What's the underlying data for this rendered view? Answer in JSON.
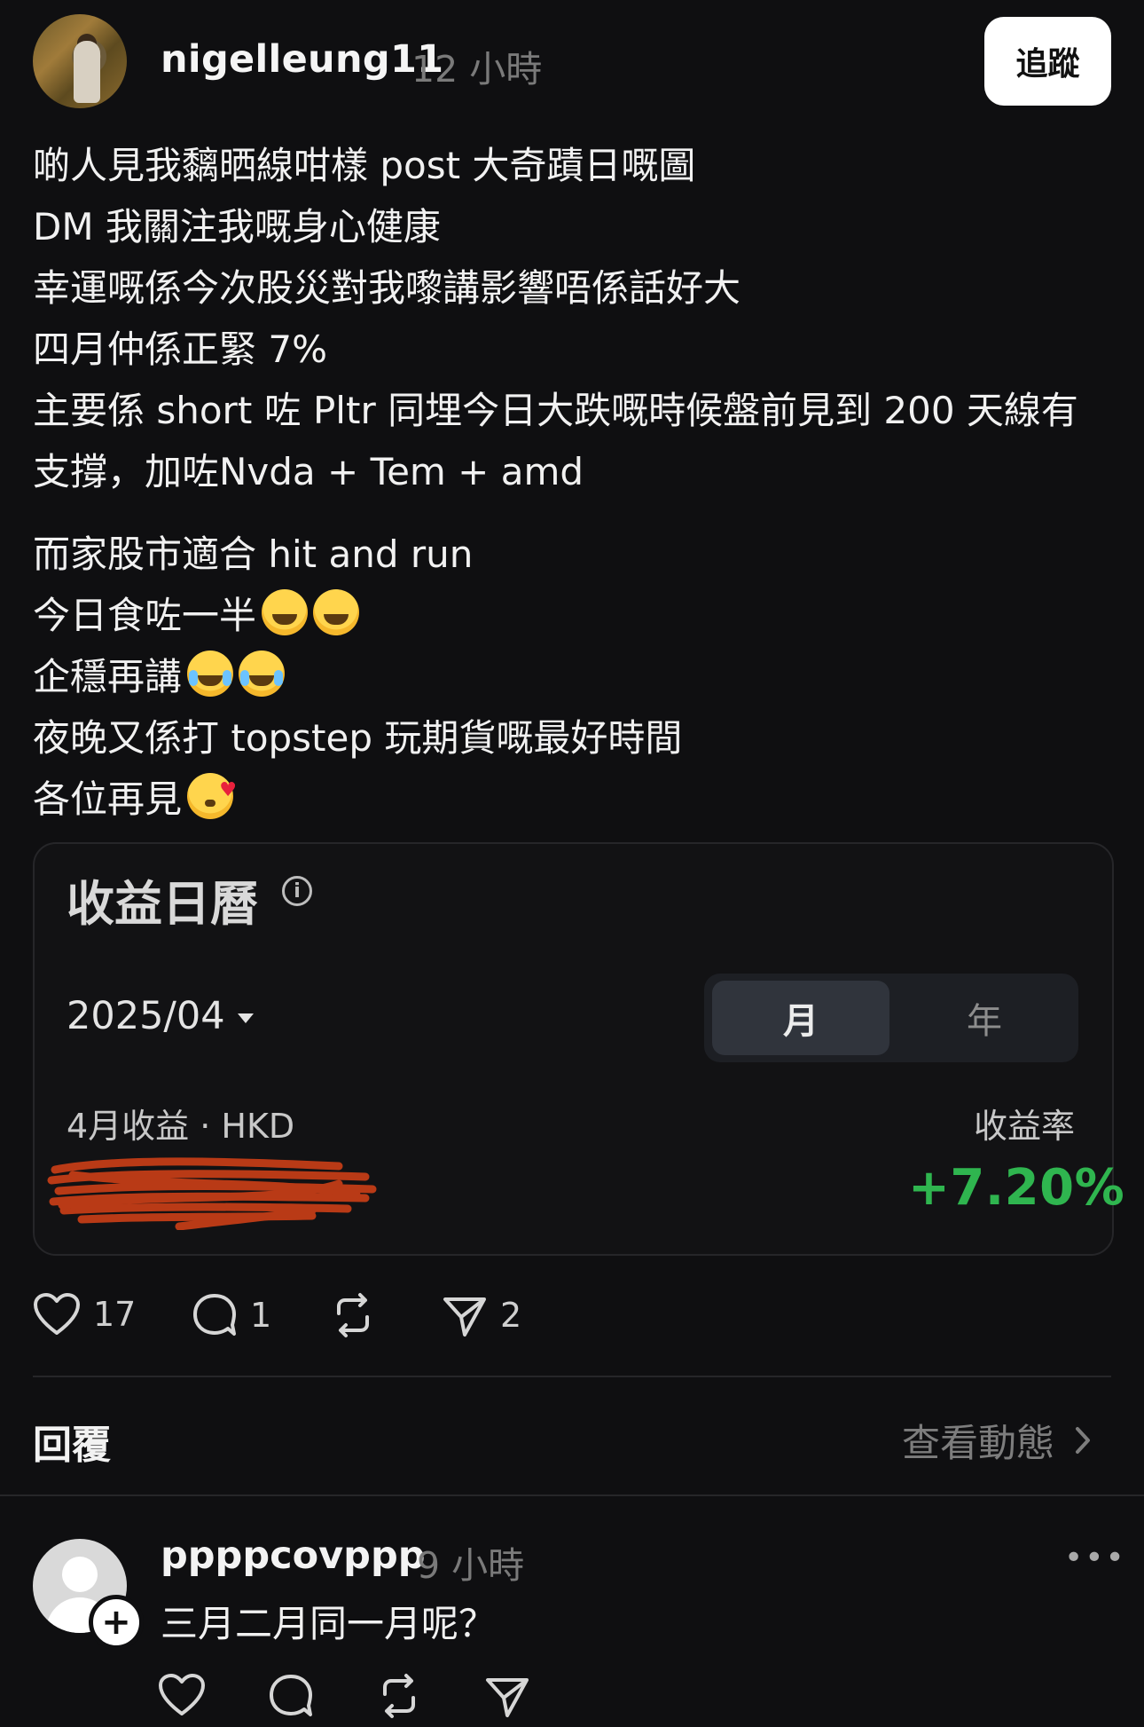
{
  "post": {
    "username": "nigelleung11",
    "time": "12 小時",
    "follow_label": "追蹤",
    "lines_a": [
      "啲人見我黐晒線咁樣 post 大奇蹟日嘅圖",
      "DM 我關注我嘅身心健康",
      "幸運嘅係今次股災對我嚟講影響唔係話好大",
      "四月仲係正緊 7%",
      "主要係 short 咗 Pltr 同埋今日大跌嘅時候盤前見到 200 天線有",
      "支撐，加咗Nvda + Tem + amd"
    ],
    "lines_b": [
      "而家股市適合 hit and run",
      "今日食咗一半",
      "企穩再講",
      "夜晚又係打 topstep 玩期貨嘅最好時間",
      "各位再見"
    ],
    "emojis": [
      "laughing-emoji",
      "laughing-emoji",
      "tears-of-joy-emoji",
      "tears-of-joy-emoji",
      "kiss-emoji"
    ]
  },
  "card": {
    "title": "收益日曆",
    "info_icon": "i",
    "date": "2025/04",
    "tab_month": "月",
    "tab_year": "年",
    "revenue_label": "4月收益 · HKD",
    "rate_label": "收益率",
    "rate_value": "+7.20%",
    "accent_green": "#2fb54f",
    "redaction_color": "#b93a16"
  },
  "actions": {
    "likes": "17",
    "comments": "1",
    "shares": "2"
  },
  "replies": {
    "label": "回覆",
    "activity_link": "查看動態"
  },
  "reply": {
    "username": "ppppcovppp",
    "time": "9 小時",
    "more": "•••",
    "plus": "+",
    "text": "三月二月同一月呢？"
  }
}
